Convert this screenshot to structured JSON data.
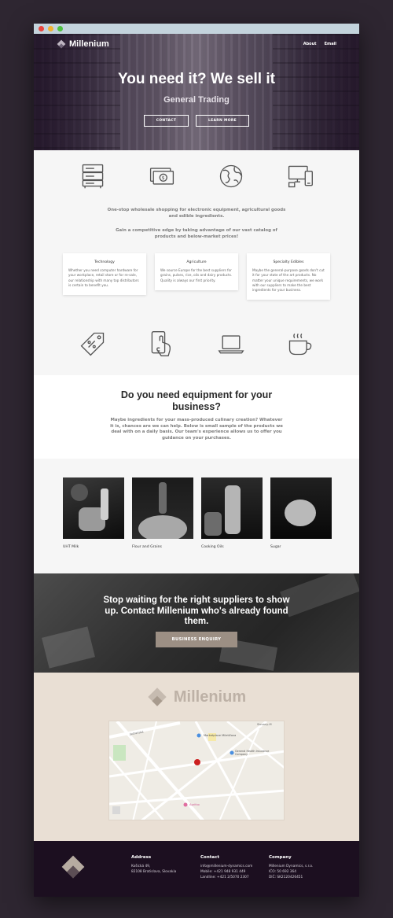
{
  "nav": {
    "brand": "Millenium",
    "links": [
      "About",
      "Email"
    ]
  },
  "hero": {
    "title": "You need it? We sell it",
    "subtitle": "General Trading",
    "buttons": {
      "contact": "CONTACT",
      "learn": "LEARN MORE"
    }
  },
  "features": {
    "tagline_1": "One-stop wholesale shopping for electronic equipment, agricultural goods and edible ingredients.",
    "tagline_2": "Gain a competitive edge by taking advantage of our vast catalog of products and below-market prices!",
    "cards": [
      {
        "title": "Technology",
        "text": "Whether you need computer hardware for your workplace, retail store or for re-sale, our relationship with many top distributors is certain to benefit you."
      },
      {
        "title": "Agriculture",
        "text": "We source Europe for the best suppliers for grains, pulses, rice, oils and dairy products. Quality is always our first priority."
      },
      {
        "title": "Specialty Edibles",
        "text": "Maybe the general-purpose goods don't cut it for your state of the art products. No matter your unique requirements, we work with our suppliers to make the best ingredients for your business."
      }
    ]
  },
  "equipment": {
    "title": "Do you need equipment for your business?",
    "text": "Maybe ingredients for your mass-produced culinary creation? Whatever it is, chances are we can help. Below is small sample of the products we deal with on a daily basis. Our team's experience allows us to offer you guidance on your purchases."
  },
  "products": [
    "UHT Milk",
    "Flour and Grains",
    "Cooking Oils",
    "Sugar"
  ],
  "cta": {
    "title": "Stop waiting for the right suppliers to show up. Contact Millenium who's already found them.",
    "button": "BUSINESS ENQUIRY"
  },
  "map": {
    "labels": {
      "street_1": "Jadranská",
      "street_2": "Slovany-M",
      "place_1": "Marketplace Miletičova",
      "place_2": "General Health Insurance Company",
      "place_3": "Agrifoo"
    }
  },
  "footer": {
    "address": {
      "heading": "Address",
      "lines": [
        "Košická 49,",
        "82108 Bratislava, Slovakia"
      ]
    },
    "contact": {
      "heading": "Contact",
      "lines": [
        "info@millenium-dynamics.com",
        "Mobile: +421 948 931 449",
        "Landline: +421 2/5070 2307"
      ]
    },
    "company": {
      "heading": "Company",
      "lines": [
        "Millenium Dynamics, s.r.o.",
        "IČO: 50 692 364",
        "DIČ: SK2120426451"
      ]
    }
  },
  "colors": {
    "accent": "#9c8f84",
    "footer_bg": "#1c0f20",
    "map_section_bg": "#e9dfd4",
    "page_bg": "#2e2631"
  }
}
